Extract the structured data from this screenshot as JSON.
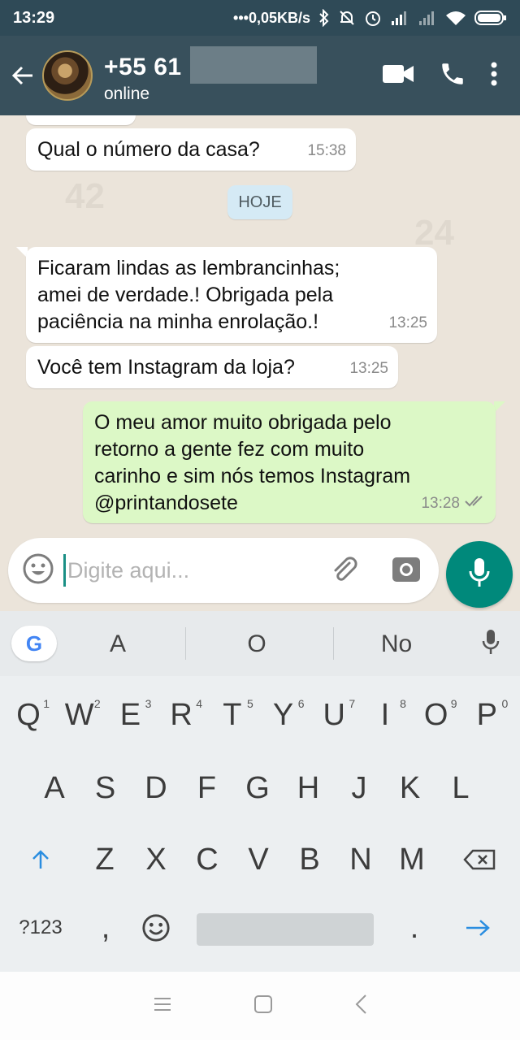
{
  "status_bar": {
    "time": "13:29",
    "network_speed": "•••0,05KB/s",
    "icons": [
      "bluetooth-icon",
      "mute-icon",
      "alarm-icon",
      "signal-icon",
      "signal-icon",
      "wifi-icon",
      "battery-icon"
    ]
  },
  "header": {
    "contact_name": "+55 61",
    "status": "online",
    "icons": [
      "back-arrow-icon",
      "video-call-icon",
      "phone-icon",
      "more-icon"
    ]
  },
  "chat": {
    "date_chip": "HOJE",
    "messages": [
      {
        "direction": "in",
        "lines": [
          "Qual o número da casa?"
        ],
        "time": "15:38"
      },
      {
        "direction": "in",
        "lines": [
          "Ficaram lindas as lembrancinhas;",
          "amei de verdade.! Obrigada pela",
          "paciência na minha enrolação.!"
        ],
        "time": "13:25"
      },
      {
        "direction": "in",
        "lines": [
          "Você tem Instagram da loja?"
        ],
        "time": "13:25"
      },
      {
        "direction": "out",
        "lines": [
          "O meu amor muito obrigada pelo",
          "retorno a gente fez com muito",
          "carinho e sim nós temos Instagram",
          "@printandosete"
        ],
        "time": "13:28",
        "read": true
      }
    ]
  },
  "composer": {
    "placeholder": "Digite aqui..."
  },
  "keyboard": {
    "suggestions": [
      "A",
      "O",
      "No"
    ],
    "row1": [
      {
        "k": "Q",
        "h": "1"
      },
      {
        "k": "W",
        "h": "2"
      },
      {
        "k": "E",
        "h": "3"
      },
      {
        "k": "R",
        "h": "4"
      },
      {
        "k": "T",
        "h": "5"
      },
      {
        "k": "Y",
        "h": "6"
      },
      {
        "k": "U",
        "h": "7"
      },
      {
        "k": "I",
        "h": "8"
      },
      {
        "k": "O",
        "h": "9"
      },
      {
        "k": "P",
        "h": "0"
      }
    ],
    "row2": [
      "A",
      "S",
      "D",
      "F",
      "G",
      "H",
      "J",
      "K",
      "L"
    ],
    "row3": [
      "Z",
      "X",
      "C",
      "V",
      "B",
      "N",
      "M"
    ],
    "symbols_key": "?123",
    "comma_key": ",",
    "period_key": "."
  },
  "colors": {
    "header": "#38505c",
    "accent": "#00897b",
    "outgoing_bubble": "#dcf8c6",
    "chat_bg": "#ebe4da"
  }
}
